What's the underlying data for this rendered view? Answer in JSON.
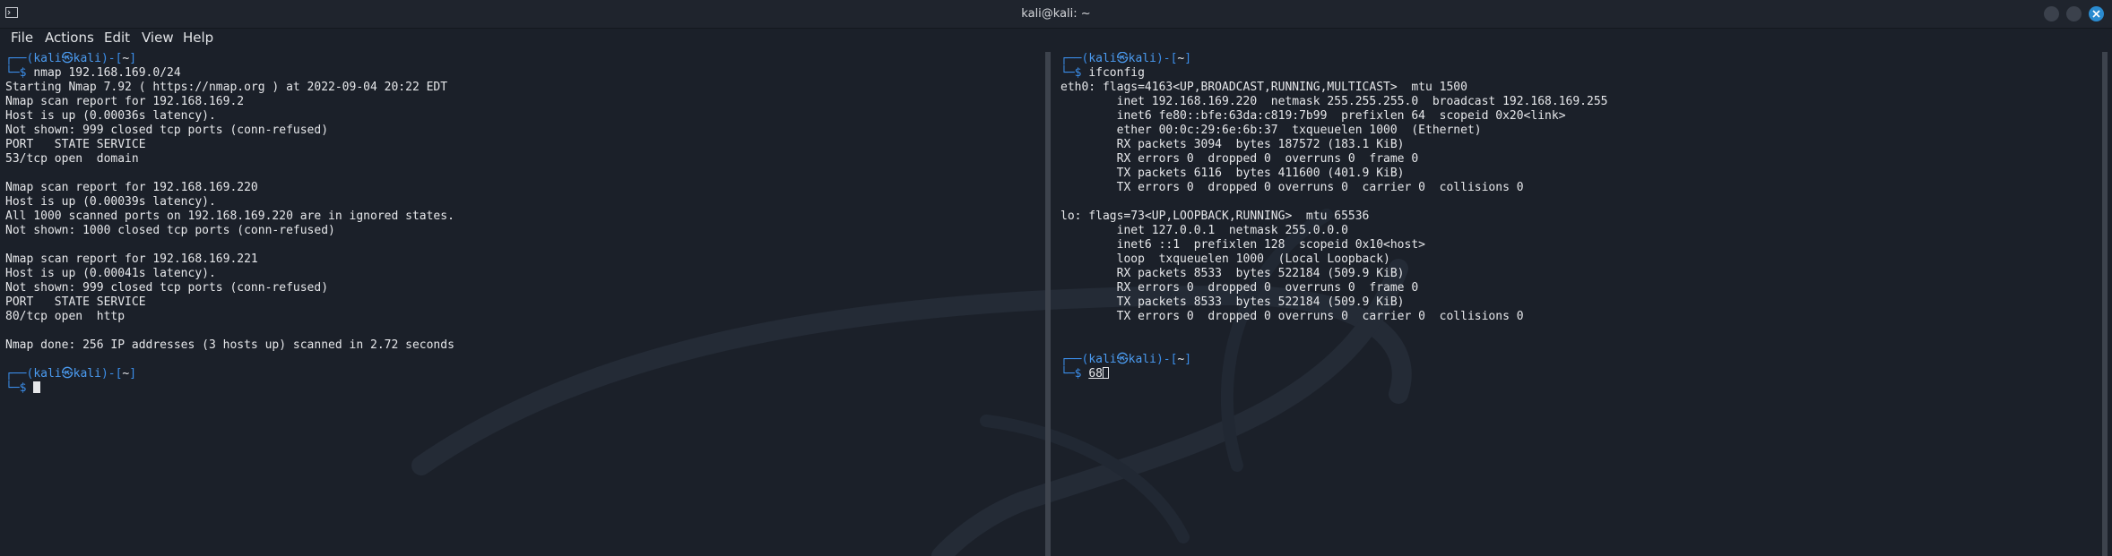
{
  "window": {
    "title": "kali@kali: ~"
  },
  "menu": [
    "File",
    "Actions",
    "Edit",
    "View",
    "Help"
  ],
  "prompt": {
    "user": "kali",
    "at": "㉿",
    "host": "kali",
    "dir": "~",
    "dollar": "$"
  },
  "left_pane": {
    "command": "nmap 192.168.169.0/24",
    "output": [
      "Starting Nmap 7.92 ( https://nmap.org ) at 2022-09-04 20:22 EDT",
      "Nmap scan report for 192.168.169.2",
      "Host is up (0.00036s latency).",
      "Not shown: 999 closed tcp ports (conn-refused)",
      "PORT   STATE SERVICE",
      "53/tcp open  domain",
      "",
      "Nmap scan report for 192.168.169.220",
      "Host is up (0.00039s latency).",
      "All 1000 scanned ports on 192.168.169.220 are in ignored states.",
      "Not shown: 1000 closed tcp ports (conn-refused)",
      "",
      "Nmap scan report for 192.168.169.221",
      "Host is up (0.00041s latency).",
      "Not shown: 999 closed tcp ports (conn-refused)",
      "PORT   STATE SERVICE",
      "80/tcp open  http",
      "",
      "Nmap done: 256 IP addresses (3 hosts up) scanned in 2.72 seconds",
      ""
    ],
    "current_input": ""
  },
  "right_pane": {
    "command": "ifconfig",
    "output": [
      "eth0: flags=4163<UP,BROADCAST,RUNNING,MULTICAST>  mtu 1500",
      "        inet 192.168.169.220  netmask 255.255.255.0  broadcast 192.168.169.255",
      "        inet6 fe80::bfe:63da:c819:7b99  prefixlen 64  scopeid 0x20<link>",
      "        ether 00:0c:29:6e:6b:37  txqueuelen 1000  (Ethernet)",
      "        RX packets 3094  bytes 187572 (183.1 KiB)",
      "        RX errors 0  dropped 0  overruns 0  frame 0",
      "        TX packets 6116  bytes 411600 (401.9 KiB)",
      "        TX errors 0  dropped 0 overruns 0  carrier 0  collisions 0",
      "",
      "lo: flags=73<UP,LOOPBACK,RUNNING>  mtu 65536",
      "        inet 127.0.0.1  netmask 255.0.0.0",
      "        inet6 ::1  prefixlen 128  scopeid 0x10<host>",
      "        loop  txqueuelen 1000  (Local Loopback)",
      "        RX packets 8533  bytes 522184 (509.9 KiB)",
      "        RX errors 0  dropped 0  overruns 0  frame 0",
      "        TX packets 8533  bytes 522184 (509.9 KiB)",
      "        TX errors 0  dropped 0 overruns 0  carrier 0  collisions 0",
      "",
      ""
    ],
    "current_input": "68"
  },
  "colors": {
    "background": "#1b2029",
    "prompt_blue": "#3b8eea",
    "text": "#e6e7ea",
    "close_button": "#2a8bd0"
  }
}
